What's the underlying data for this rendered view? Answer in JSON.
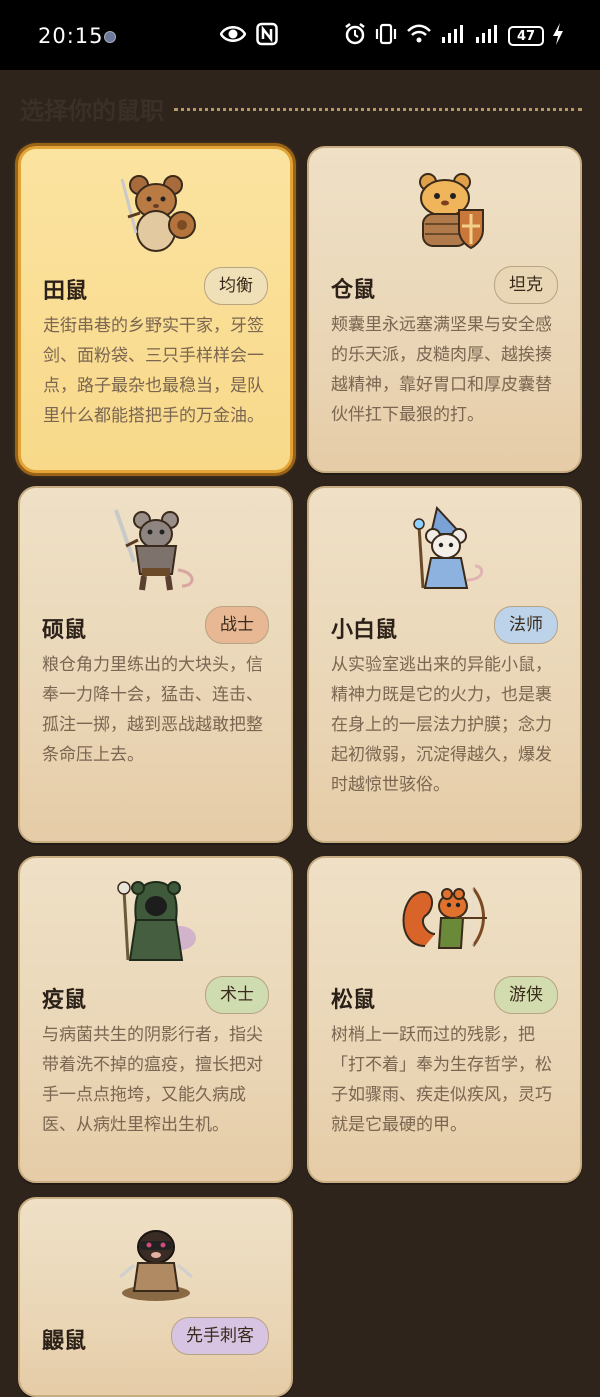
{
  "status_bar": {
    "time": "20:15",
    "battery": "47"
  },
  "page": {
    "heading": "选择你的鼠职"
  },
  "classes": [
    {
      "name": "田鼠",
      "tag": "均衡",
      "tag_color": "#efe0b8",
      "icon": "field-mouse-swordsman-icon",
      "desc": "走街串巷的乡野实干家，牙签剑、面粉袋、三只手样样会一点，路子最杂也最稳当，是队里什么都能搭把手的万金油。",
      "selected": true
    },
    {
      "name": "仓鼠",
      "tag": "坦克",
      "tag_color": "#e8d6b4",
      "icon": "hamster-knight-icon",
      "desc": "颊囊里永远塞满坚果与安全感的乐天派，皮糙肉厚、越挨揍越精神，靠好胃口和厚皮囊替伙伴扛下最狠的打。",
      "selected": false
    },
    {
      "name": "硕鼠",
      "tag": "战士",
      "tag_color": "#e8b894",
      "icon": "big-rat-warrior-icon",
      "desc": "粮仓角力里练出的大块头，信奉一力降十会，猛击、连击、孤注一掷，越到恶战越敢把整条命压上去。",
      "selected": false
    },
    {
      "name": "小白鼠",
      "tag": "法师",
      "tag_color": "#bcd3ea",
      "icon": "white-mouse-mage-icon",
      "desc": "从实验室逃出来的异能小鼠，精神力既是它的火力，也是裹在身上的一层法力护膜；念力起初微弱，沉淀得越久，爆发时越惊世骇俗。",
      "selected": false
    },
    {
      "name": "疫鼠",
      "tag": "术士",
      "tag_color": "#cfdcb0",
      "icon": "plague-rat-warlock-icon",
      "desc": "与病菌共生的阴影行者，指尖带着洗不掉的瘟疫，擅长把对手一点点拖垮，又能久病成医、从病灶里榨出生机。",
      "selected": false
    },
    {
      "name": "松鼠",
      "tag": "游侠",
      "tag_color": "#d3dcae",
      "icon": "squirrel-ranger-icon",
      "desc": "树梢上一跃而过的残影，把「打不着」奉为生存哲学，松子如骤雨、疾走似疾风，灵巧就是它最硬的甲。",
      "selected": false
    },
    {
      "name": "鼹鼠",
      "tag": "先手刺客",
      "tag_color": "#d6c4e2",
      "icon": "mole-assassin-icon",
      "desc": "",
      "selected": false
    }
  ]
}
